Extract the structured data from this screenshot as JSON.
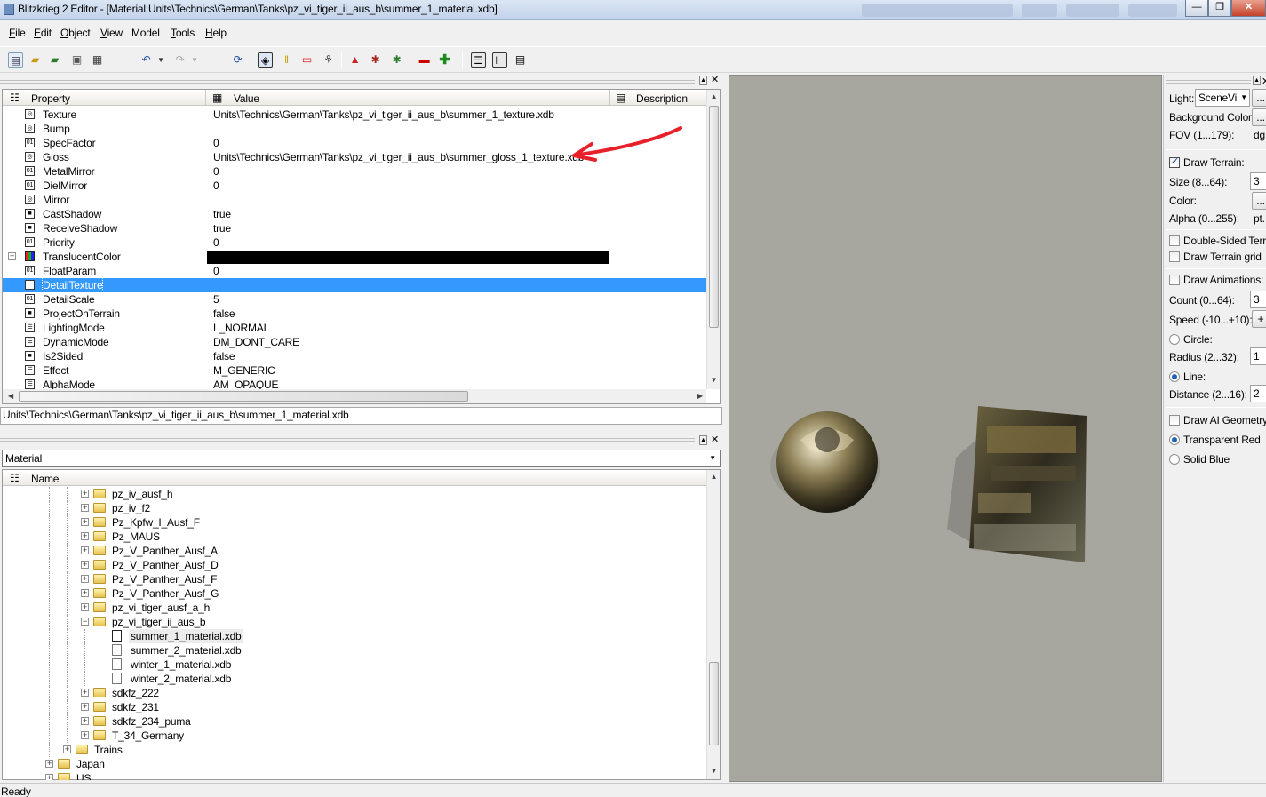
{
  "window": {
    "title": "Blitzkrieg 2 Editor - [Material:Units\\Technics\\German\\Tanks\\pz_vi_tiger_ii_aus_b\\summer_1_material.xdb]",
    "min": "—",
    "max": "❐",
    "close": "✕"
  },
  "menu": [
    {
      "label": "File",
      "ul": "F",
      "rest": "ile"
    },
    {
      "label": "Edit",
      "ul": "E",
      "rest": "dit"
    },
    {
      "label": "Object",
      "ul": "O",
      "rest": "bject"
    },
    {
      "label": "View",
      "ul": "V",
      "rest": "iew"
    },
    {
      "label": "Model",
      "ul": "",
      "rest": "Model"
    },
    {
      "label": "Tools",
      "ul": "T",
      "rest": "ools"
    },
    {
      "label": "Help",
      "ul": "H",
      "rest": "elp"
    }
  ],
  "property_grid": {
    "headers": {
      "property": "Property",
      "value": "Value",
      "description": "Description"
    },
    "rows": [
      {
        "name": "Texture",
        "value": "Units\\Technics\\German\\Tanks\\pz_vi_tiger_ii_aus_b\\summer_1_texture.xdb",
        "icon": "texture-icon"
      },
      {
        "name": "Bump",
        "value": "",
        "icon": "texture-icon"
      },
      {
        "name": "SpecFactor",
        "value": "0",
        "icon": "number-icon"
      },
      {
        "name": "Gloss",
        "value": "Units\\Technics\\German\\Tanks\\pz_vi_tiger_ii_aus_b\\summer_gloss_1_texture.xdb",
        "icon": "texture-icon"
      },
      {
        "name": "MetalMirror",
        "value": "0",
        "icon": "number-icon"
      },
      {
        "name": "DielMirror",
        "value": "0",
        "icon": "number-icon"
      },
      {
        "name": "Mirror",
        "value": "",
        "icon": "texture-icon"
      },
      {
        "name": "CastShadow",
        "value": "true",
        "icon": "bool-icon"
      },
      {
        "name": "ReceiveShadow",
        "value": "true",
        "icon": "bool-icon"
      },
      {
        "name": "Priority",
        "value": "0",
        "icon": "number-icon"
      },
      {
        "name": "TranslucentColor",
        "value": "",
        "icon": "color-icon"
      },
      {
        "name": "FloatParam",
        "value": "0",
        "icon": "number-icon"
      },
      {
        "name": "DetailTexture",
        "value": "",
        "icon": "texture-icon"
      },
      {
        "name": "DetailScale",
        "value": "5",
        "icon": "number-icon"
      },
      {
        "name": "ProjectOnTerrain",
        "value": "false",
        "icon": "bool-icon"
      },
      {
        "name": "LightingMode",
        "value": "L_NORMAL",
        "icon": "enum-icon"
      },
      {
        "name": "DynamicMode",
        "value": "DM_DONT_CARE",
        "icon": "enum-icon"
      },
      {
        "name": "Is2Sided",
        "value": "false",
        "icon": "bool-icon"
      },
      {
        "name": "Effect",
        "value": "M_GENERIC",
        "icon": "enum-icon"
      },
      {
        "name": "AlphaMode",
        "value": "AM_OPAQUE",
        "icon": "enum-icon"
      }
    ],
    "selected_index": 12,
    "status_path": "Units\\Technics\\German\\Tanks\\pz_vi_tiger_ii_aus_b\\summer_1_material.xdb"
  },
  "browser": {
    "type_select": "Material",
    "name_header": "Name",
    "items": [
      {
        "label": "pz_iv_ausf_h",
        "kind": "folder",
        "level": 3,
        "expander": "+"
      },
      {
        "label": "pz_iv_f2",
        "kind": "folder",
        "level": 3,
        "expander": "+"
      },
      {
        "label": "Pz_Kpfw_I_Ausf_F",
        "kind": "folder",
        "level": 3,
        "expander": "+"
      },
      {
        "label": "Pz_MAUS",
        "kind": "folder",
        "level": 3,
        "expander": "+"
      },
      {
        "label": "Pz_V_Panther_Ausf_A",
        "kind": "folder",
        "level": 3,
        "expander": "+"
      },
      {
        "label": "Pz_V_Panther_Ausf_D",
        "kind": "folder",
        "level": 3,
        "expander": "+"
      },
      {
        "label": "Pz_V_Panther_Ausf_F",
        "kind": "folder",
        "level": 3,
        "expander": "+"
      },
      {
        "label": "Pz_V_Panther_Ausf_G",
        "kind": "folder",
        "level": 3,
        "expander": "+"
      },
      {
        "label": "pz_vi_tiger_ausf_a_h",
        "kind": "folder",
        "level": 3,
        "expander": "+"
      },
      {
        "label": "pz_vi_tiger_ii_aus_b",
        "kind": "folder",
        "level": 3,
        "expander": "−"
      },
      {
        "label": "summer_1_material.xdb",
        "kind": "file",
        "level": 4,
        "expander": "",
        "selected": true
      },
      {
        "label": "summer_2_material.xdb",
        "kind": "file",
        "level": 4,
        "expander": ""
      },
      {
        "label": "winter_1_material.xdb",
        "kind": "file",
        "level": 4,
        "expander": ""
      },
      {
        "label": "winter_2_material.xdb",
        "kind": "file",
        "level": 4,
        "expander": ""
      },
      {
        "label": "sdkfz_222",
        "kind": "folder",
        "level": 3,
        "expander": "+"
      },
      {
        "label": "sdkfz_231",
        "kind": "folder",
        "level": 3,
        "expander": "+"
      },
      {
        "label": "sdkfz_234_puma",
        "kind": "folder",
        "level": 3,
        "expander": "+"
      },
      {
        "label": "T_34_Germany",
        "kind": "folder",
        "level": 3,
        "expander": "+"
      },
      {
        "label": "Trains",
        "kind": "folder",
        "level": 2,
        "expander": "+"
      },
      {
        "label": "Japan",
        "kind": "folder",
        "level": 1,
        "expander": "+"
      },
      {
        "label": "US",
        "kind": "folder",
        "level": 1,
        "expander": "+"
      }
    ]
  },
  "settings": {
    "light_label": "Light:",
    "light_value": "SceneVi",
    "light_btn": "...",
    "bg_color_label": "Background Color:",
    "bg_color_btn": "...",
    "fov_label": "FOV (1...179):",
    "fov_value": "dg.",
    "draw_terrain": {
      "label": "Draw Terrain:",
      "checked": true
    },
    "size_label": "Size (8...64):",
    "size_value": "3",
    "color_label": "Color:",
    "color_btn": "...",
    "alpha_label": "Alpha (0...255):",
    "alpha_value": "pt.",
    "double_sided": {
      "label": "Double-Sided Terrain",
      "checked": false
    },
    "terrain_grid": {
      "label": "Draw Terrain grid",
      "checked": false
    },
    "draw_animations": {
      "label": "Draw Animations:",
      "checked": false
    },
    "count_label": "Count (0...64):",
    "count_value": "3",
    "speed_label": "Speed (-10...+10):",
    "speed_value": "+",
    "circle_label": "Circle:",
    "radius_label": "Radius (2...32):",
    "radius_value": "1",
    "line_label": "Line:",
    "distance_label": "Distance (2...16):",
    "distance_value": "2",
    "draw_ai": {
      "label": "Draw AI Geometry:",
      "checked": false
    },
    "transparent_red": "Transparent Red",
    "solid_blue": "Solid Blue"
  },
  "status_bar": {
    "text": "Ready"
  },
  "colors": {
    "selection": "#3399ff",
    "viewport": "#a8a79f",
    "annotation_arrow": "#e8202a"
  }
}
